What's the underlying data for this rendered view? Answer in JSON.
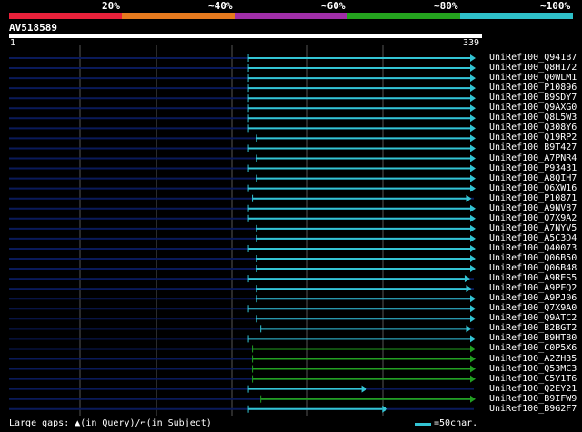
{
  "header": {
    "percent_labels": [
      "20%",
      "~40%",
      "~60%",
      "~80%",
      "~100%"
    ],
    "scale_colors": [
      "#e8213a",
      "#e67a1e",
      "#a02ea8",
      "#24a31e",
      "#2ec0c8"
    ]
  },
  "query": {
    "name": "AV518589",
    "start_label": "1",
    "end_label": "339"
  },
  "colors": {
    "query_line": "#0a1a5a",
    "high_identity": "#33c4d4",
    "mid_identity": "#22a022",
    "grid": "#555555"
  },
  "hits": [
    {
      "label": "UniRef100_Q941B7",
      "start": 175,
      "end": 339,
      "color": "cyan"
    },
    {
      "label": "UniRef100_Q8H172",
      "start": 175,
      "end": 339,
      "color": "cyan"
    },
    {
      "label": "UniRef100_Q0WLM1",
      "start": 175,
      "end": 339,
      "color": "cyan"
    },
    {
      "label": "UniRef100_P10896",
      "start": 175,
      "end": 339,
      "color": "cyan"
    },
    {
      "label": "UniRef100_B9SDY7",
      "start": 175,
      "end": 339,
      "color": "cyan"
    },
    {
      "label": "UniRef100_Q9AXG0",
      "start": 175,
      "end": 339,
      "color": "cyan"
    },
    {
      "label": "UniRef100_Q8L5W3",
      "start": 175,
      "end": 339,
      "color": "cyan"
    },
    {
      "label": "UniRef100_Q308Y6",
      "start": 175,
      "end": 339,
      "color": "cyan"
    },
    {
      "label": "UniRef100_Q19RP2",
      "start": 181,
      "end": 339,
      "color": "cyan"
    },
    {
      "label": "UniRef100_B9T427",
      "start": 175,
      "end": 339,
      "color": "cyan"
    },
    {
      "label": "UniRef100_A7PNR4",
      "start": 181,
      "end": 339,
      "color": "cyan"
    },
    {
      "label": "UniRef100_P93431",
      "start": 175,
      "end": 339,
      "color": "cyan"
    },
    {
      "label": "UniRef100_A8QIH7",
      "start": 181,
      "end": 339,
      "color": "cyan"
    },
    {
      "label": "UniRef100_Q6XW16",
      "start": 175,
      "end": 339,
      "color": "cyan"
    },
    {
      "label": "UniRef100_P10871",
      "start": 178,
      "end": 336,
      "color": "cyan"
    },
    {
      "label": "UniRef100_A9NV87",
      "start": 175,
      "end": 339,
      "color": "cyan"
    },
    {
      "label": "UniRef100_Q7X9A2",
      "start": 175,
      "end": 339,
      "color": "cyan"
    },
    {
      "label": "UniRef100_A7NYV5",
      "start": 181,
      "end": 339,
      "color": "cyan"
    },
    {
      "label": "UniRef100_A5C3D4",
      "start": 181,
      "end": 339,
      "color": "cyan"
    },
    {
      "label": "UniRef100_Q40073",
      "start": 175,
      "end": 339,
      "color": "cyan"
    },
    {
      "label": "UniRef100_Q06B50",
      "start": 181,
      "end": 339,
      "color": "cyan"
    },
    {
      "label": "UniRef100_Q06B48",
      "start": 181,
      "end": 339,
      "color": "cyan"
    },
    {
      "label": "UniRef100_A9RES5",
      "start": 175,
      "end": 335,
      "color": "cyan"
    },
    {
      "label": "UniRef100_A9PFQ2",
      "start": 181,
      "end": 336,
      "color": "cyan"
    },
    {
      "label": "UniRef100_A9PJ06",
      "start": 181,
      "end": 339,
      "color": "cyan"
    },
    {
      "label": "UniRef100_Q7X9A0",
      "start": 175,
      "end": 339,
      "color": "cyan"
    },
    {
      "label": "UniRef100_Q9ATC2",
      "start": 181,
      "end": 339,
      "color": "cyan"
    },
    {
      "label": "UniRef100_B2BGT2",
      "start": 184,
      "end": 336,
      "color": "cyan"
    },
    {
      "label": "UniRef100_B9HT80",
      "start": 175,
      "end": 339,
      "color": "cyan"
    },
    {
      "label": "UniRef100_C0P5X6",
      "start": 178,
      "end": 339,
      "color": "green"
    },
    {
      "label": "UniRef100_A2ZH35",
      "start": 178,
      "end": 339,
      "color": "green"
    },
    {
      "label": "UniRef100_Q53MC3",
      "start": 178,
      "end": 339,
      "color": "green"
    },
    {
      "label": "UniRef100_C5Y1T6",
      "start": 178,
      "end": 339,
      "color": "green"
    },
    {
      "label": "UniRef100_Q2EY21",
      "start": 175,
      "end": 260,
      "color": "cyan"
    },
    {
      "label": "UniRef100_B9IFW9",
      "start": 184,
      "end": 339,
      "color": "green"
    },
    {
      "label": "UniRef100_B9G2F7",
      "start": 175,
      "end": 275,
      "color": "cyan"
    }
  ],
  "footer": {
    "gaps_label": "Large gaps:",
    "query_gap_text": "(in Query)/",
    "subject_gap_text": "(in Subject)",
    "scale_text": "=50char."
  }
}
